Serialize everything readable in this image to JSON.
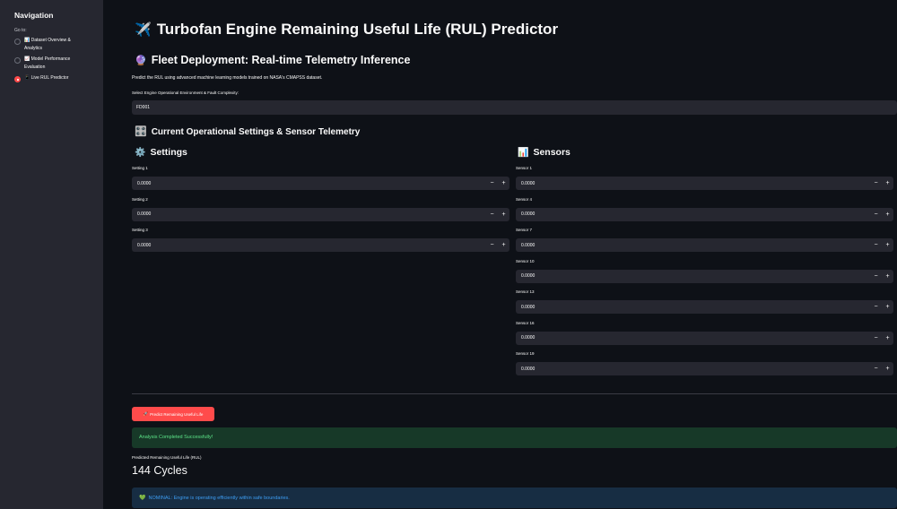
{
  "sidebar": {
    "title": "Navigation",
    "goto_label": "Go to:",
    "options": [
      {
        "icon": "📊",
        "label": "Dataset Overview & Analytics",
        "selected": false
      },
      {
        "icon": "📈",
        "label": "Model Performance Evaluation",
        "selected": false
      },
      {
        "icon": "📱",
        "label": "Live RUL Predictor",
        "selected": true
      }
    ]
  },
  "header": {
    "title_icon": "✈️",
    "title": "Turbofan Engine Remaining Useful Life (RUL) Predictor",
    "subtitle_icon": "🔮",
    "subtitle": "Fleet Deployment: Real-time Telemetry Inference",
    "description": "Predict the RUL using advanced machine learning models trained on NASA's CMAPSS dataset."
  },
  "environment": {
    "label": "Select Engine Operational Environment & Fault Complexity:",
    "value": "FD001"
  },
  "telemetry": {
    "heading_icon": "🎛️",
    "heading": "Current Operational Settings & Sensor Telemetry"
  },
  "settings": {
    "heading_icon": "⚙️",
    "heading": "Settings",
    "fields": [
      {
        "label": "Setting 1",
        "value": "0.0000"
      },
      {
        "label": "Setting 2",
        "value": "0.0000"
      },
      {
        "label": "Setting 3",
        "value": "0.0000"
      }
    ]
  },
  "sensors": {
    "heading_icon": "📊",
    "heading": "Sensors",
    "fields": [
      {
        "label": "Sensor 1",
        "value": "0.0000"
      },
      {
        "label": "Sensor 4",
        "value": "0.0000"
      },
      {
        "label": "Sensor 7",
        "value": "0.0000"
      },
      {
        "label": "Sensor 10",
        "value": "0.0000"
      },
      {
        "label": "Sensor 13",
        "value": "0.0000"
      },
      {
        "label": "Sensor 16",
        "value": "0.0000"
      },
      {
        "label": "Sensor 19",
        "value": "0.0000"
      }
    ]
  },
  "stepper": {
    "minus": "−",
    "plus": "+"
  },
  "action": {
    "icon": "🚀",
    "label": "Predict Remaining Useful Life"
  },
  "result": {
    "success": "Analysis Completed Successfully!",
    "metric_label": "Predicted Remaining Useful Life (RUL)",
    "metric_value": "144 Cycles",
    "status_icon": "💚",
    "status": "NOMINAL: Engine is operating efficiently within safe boundaries."
  },
  "colors": {
    "accent": "#ff4b4b",
    "background": "#0e1117",
    "sidebar": "#262730",
    "success_bg": "#173928",
    "info_bg": "#172d43"
  }
}
